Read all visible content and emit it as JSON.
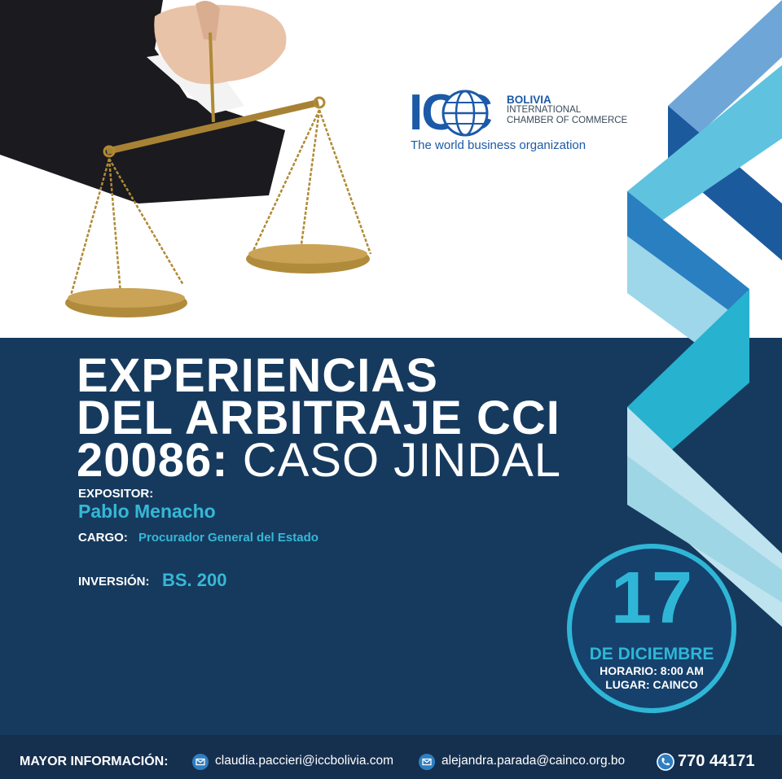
{
  "logo": {
    "mark": "ICC",
    "country": "BOLIVIA",
    "line1": "INTERNATIONAL",
    "line2": "CHAMBER OF COMMERCE",
    "tagline": "The world business organization"
  },
  "event": {
    "title_line1": "EXPERIENCIAS",
    "title_line2": "DEL ARBITRAJE CCI",
    "title_line3_bold": "20086:",
    "title_line3_thin": "CASO JINDAL",
    "speaker_label": "EXPOSITOR:",
    "speaker_name": "Pablo Menacho",
    "role_label": "CARGO:",
    "role_value": "Procurador General del Estado",
    "price_label": "INVERSIÓN:",
    "price_value": "BS. 200"
  },
  "date": {
    "day": "17",
    "month": "DE DICIEMBRE",
    "time": "HORARIO: 8:00 AM",
    "place": "LUGAR: CAINCO"
  },
  "footer": {
    "label": "MAYOR INFORMACIÓN:",
    "email1": "claudia.paccieri@iccbolivia.com",
    "email2": "alejandra.parada@cainco.org.bo",
    "phone": "770 44171",
    "email_icon": "envelope-icon",
    "phone_icon": "phone-icon"
  },
  "colors": {
    "navy": "#163a5e",
    "accent": "#2fb6d6",
    "brand_blue": "#1c5aa8"
  }
}
